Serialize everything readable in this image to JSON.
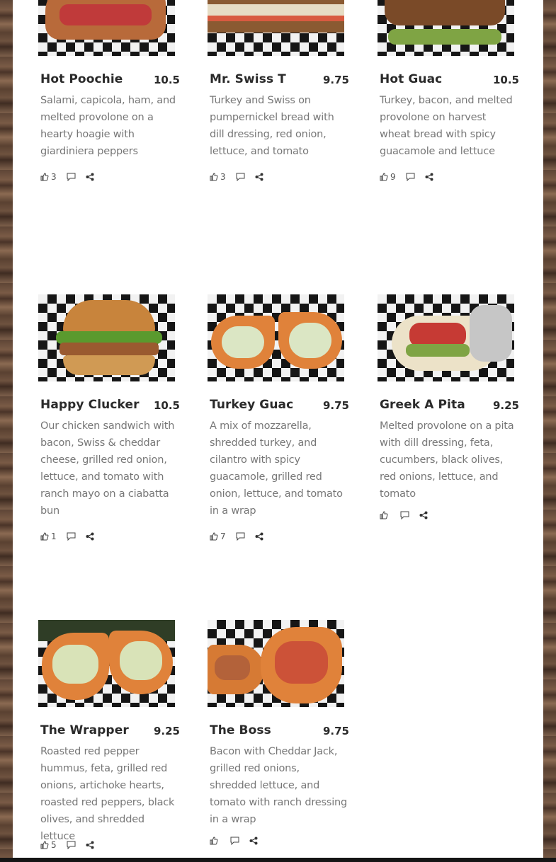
{
  "menu_items": [
    {
      "name": "Hot Poochie",
      "price": "10.5",
      "description": "Salami, capicola, ham, and melted provolone on a hearty hoagie with giardiniera peppers",
      "likes": "3",
      "icons": [
        "thumbs-up-icon",
        "comment-icon",
        "share-icon"
      ]
    },
    {
      "name": "Mr. Swiss T",
      "price": "9.75",
      "description": "Turkey and Swiss on pumpernickel bread with dill dressing, red onion, lettuce, and tomato",
      "likes": "3",
      "icons": [
        "thumbs-up-icon",
        "comment-icon",
        "share-icon"
      ]
    },
    {
      "name": "Hot Guac",
      "price": "10.5",
      "description": "Turkey, bacon, and melted provolone on harvest wheat bread with spicy guacamole and lettuce",
      "likes": "9",
      "icons": [
        "thumbs-up-icon",
        "comment-icon",
        "share-icon"
      ]
    },
    {
      "name": "Happy Clucker",
      "price": "10.5",
      "description": "Our chicken sandwich with bacon, Swiss & cheddar cheese, grilled red onion, lettuce, and tomato with ranch mayo on a ciabatta bun",
      "likes": "1",
      "icons": [
        "thumbs-up-icon",
        "comment-icon",
        "share-icon"
      ]
    },
    {
      "name": "Turkey Guac",
      "price": "9.75",
      "description": "A mix of mozzarella, shredded turkey, and cilantro with spicy guacamole, grilled red onion, lettuce, and tomato in a wrap",
      "likes": "7",
      "icons": [
        "thumbs-up-icon",
        "comment-icon",
        "share-icon"
      ]
    },
    {
      "name": "Greek A Pita",
      "price": "9.25",
      "description": "Melted provolone on a pita with dill dressing, feta, cucumbers, black olives, red onions, lettuce, and tomato",
      "likes": "",
      "icons": [
        "thumbs-up-icon",
        "comment-icon",
        "share-icon"
      ]
    },
    {
      "name": "The Wrapper",
      "price": "9.25",
      "description": "Roasted red pepper hummus, feta, grilled red onions, artichoke hearts, roasted red peppers, black olives, and shredded lettuce",
      "likes": "5",
      "icons": [
        "thumbs-up-icon",
        "comment-icon",
        "share-icon"
      ]
    },
    {
      "name": "The Boss",
      "price": "9.75",
      "description": "Bacon with Cheddar Jack, grilled red onions, shredded lettuce, and tomato with ranch dressing in a wrap",
      "likes": "",
      "icons": [
        "thumbs-up-icon",
        "comment-icon",
        "share-icon"
      ]
    }
  ],
  "colors": {
    "title": "#2a2a2a",
    "description": "#777777",
    "background_wood": "#6a4e3c",
    "panel": "#ffffff"
  }
}
